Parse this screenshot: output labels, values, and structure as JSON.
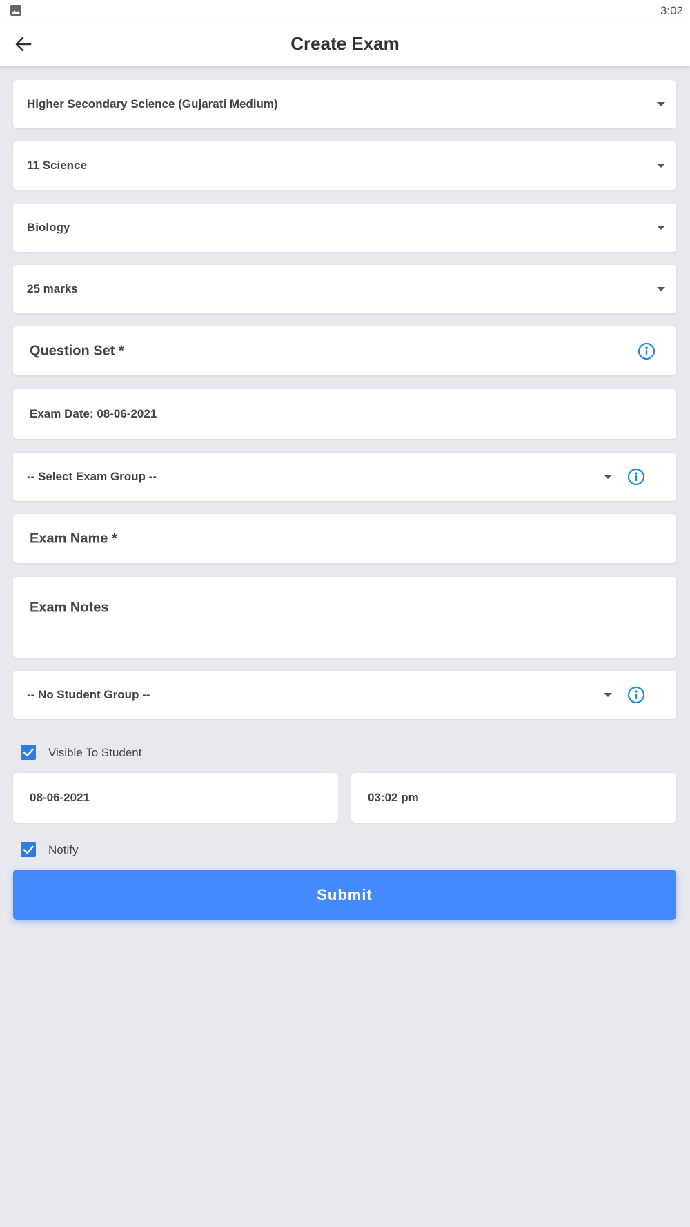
{
  "status_bar": {
    "time": "3:02"
  },
  "app_bar": {
    "title": "Create Exam"
  },
  "form": {
    "board_select": "Higher Secondary Science (Gujarati Medium)",
    "standard_select": "11 Science",
    "subject_select": "Biology",
    "marks_select": "25 marks",
    "question_set_label": "Question Set *",
    "exam_date": "Exam Date: 08-06-2021",
    "exam_group_select": "-- Select Exam Group --",
    "exam_name_label": "Exam Name *",
    "exam_notes_label": "Exam Notes",
    "student_group_select": "-- No Student Group --",
    "visible_to_student": {
      "label": "Visible To Student",
      "checked": true
    },
    "visible_date": "08-06-2021",
    "visible_time": "03:02 pm",
    "notify": {
      "label": "Notify",
      "checked": true
    },
    "submit_label": "Submit"
  },
  "colors": {
    "accent": "#448aff",
    "info_icon": "#1e88e5",
    "checkbox": "#2f7de1",
    "background": "#e8e9ef"
  },
  "icons": [
    "image-icon",
    "back-arrow-icon",
    "chevron-down-icon",
    "info-icon",
    "checkmark-icon"
  ]
}
